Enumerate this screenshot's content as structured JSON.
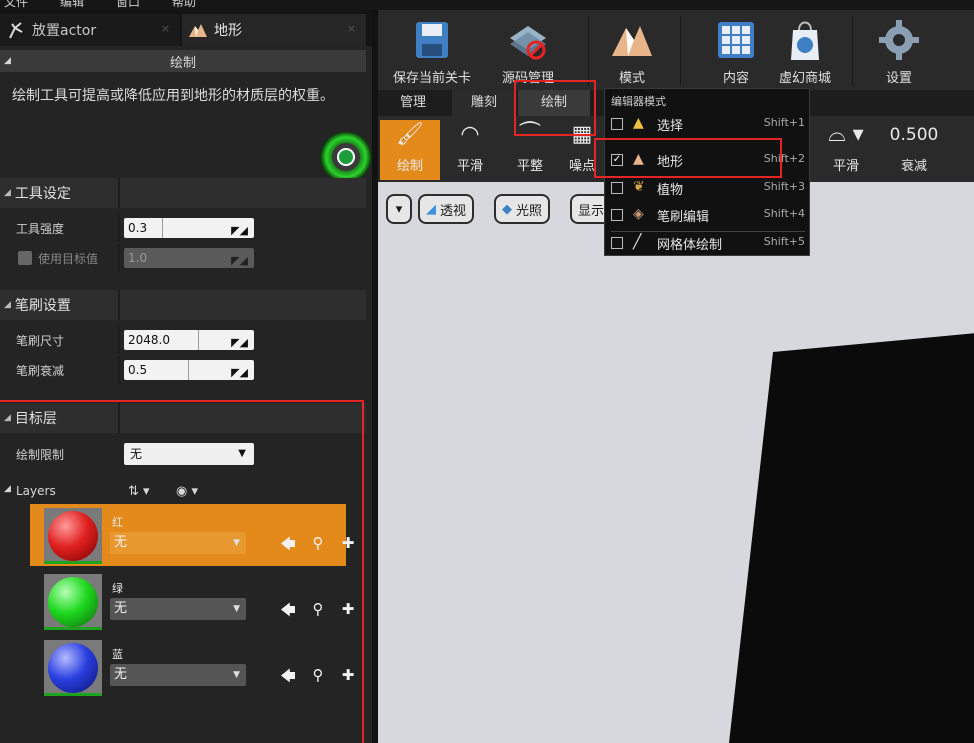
{
  "menubar": [
    "文件",
    "编辑",
    "窗口",
    "帮助"
  ],
  "tabs": [
    {
      "label": "放置actor",
      "close": "×"
    },
    {
      "label": "地形",
      "close": "×"
    }
  ],
  "paint_panel": {
    "header": "绘制",
    "description": "绘制工具可提高或降低应用到地形的材质层的权重。"
  },
  "tool_settings": {
    "header": "工具设定",
    "strength_label": "工具强度",
    "strength_value": "0.3",
    "strength_fraction": 0.3,
    "use_target_label": "使用目标值",
    "use_target_value": "1.0"
  },
  "brush_settings": {
    "header": "笔刷设置",
    "size_label": "笔刷尺寸",
    "size_value": "2048.0",
    "size_fraction": 0.58,
    "falloff_label": "笔刷衰减",
    "falloff_value": "0.5",
    "falloff_fraction": 0.5
  },
  "target_layers": {
    "header": "目标层",
    "limit_label": "绘制限制",
    "limit_value": "无",
    "layers_label": "Layers",
    "layers": [
      {
        "name": "红",
        "value": "无",
        "color": "#e02020"
      },
      {
        "name": "绿",
        "value": "无",
        "color": "#1ed81e"
      },
      {
        "name": "蓝",
        "value": "无",
        "color": "#2a3fe0"
      }
    ]
  },
  "toolbar": {
    "save": "保存当前关卡",
    "source": "源码管理",
    "modes": "模式",
    "content": "内容",
    "market": "虚幻商城",
    "settings": "设置"
  },
  "mode_tabs": [
    "管理",
    "雕刻",
    "绘制"
  ],
  "tools": [
    {
      "label": "绘制",
      "icon": "brush-icon"
    },
    {
      "label": "平滑",
      "icon": "smooth-icon"
    },
    {
      "label": "平整",
      "icon": "flatten-icon"
    },
    {
      "label": "噪点",
      "icon": "noise-icon"
    }
  ],
  "falloff_shape": {
    "label": "平滑"
  },
  "falloff_value": {
    "value": "0.500",
    "label": "衰减"
  },
  "viewport": {
    "perspective": "透视",
    "lit": "光照",
    "show": "显示"
  },
  "editor_modes": {
    "header": "编辑器模式",
    "items": [
      {
        "label": "选择",
        "shortcut": "Shift+1",
        "checked": false
      },
      {
        "label": "地形",
        "shortcut": "Shift+2",
        "checked": true
      },
      {
        "label": "植物",
        "shortcut": "Shift+3",
        "checked": false
      },
      {
        "label": "笔刷编辑",
        "shortcut": "Shift+4",
        "checked": false
      },
      {
        "label": "网格体绘制",
        "shortcut": "Shift+5",
        "checked": false
      }
    ]
  },
  "colors": {
    "accent": "#e38a1b",
    "highlight": "#e52525"
  }
}
